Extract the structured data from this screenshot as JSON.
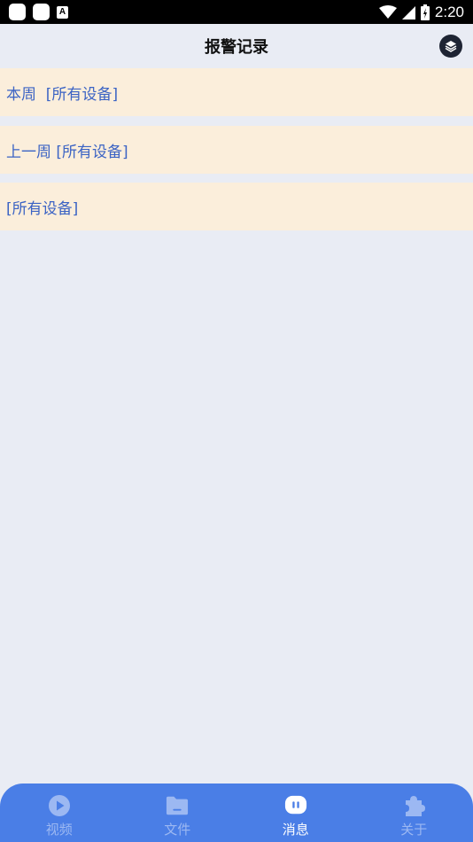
{
  "status_bar": {
    "time": "2:20",
    "notification_letter": "A"
  },
  "header": {
    "title": "报警记录",
    "layers_icon": "layers-icon"
  },
  "records": [
    {
      "label": "本周  [所有设备]"
    },
    {
      "label": "上一周 [所有设备]"
    },
    {
      "label": "[所有设备]"
    }
  ],
  "bottom_nav": {
    "items": [
      {
        "label": "视频",
        "icon": "play-icon",
        "active": false
      },
      {
        "label": "文件",
        "icon": "folder-icon",
        "active": false
      },
      {
        "label": "消息",
        "icon": "message-icon",
        "active": true
      },
      {
        "label": "关于",
        "icon": "puzzle-icon",
        "active": false
      }
    ]
  },
  "colors": {
    "background": "#e9ecf4",
    "record_background": "#fbeedb",
    "record_text": "#3b63c4",
    "nav_background": "#4a7ee6",
    "nav_inactive": "#9cb8f2",
    "nav_active": "#ffffff"
  }
}
